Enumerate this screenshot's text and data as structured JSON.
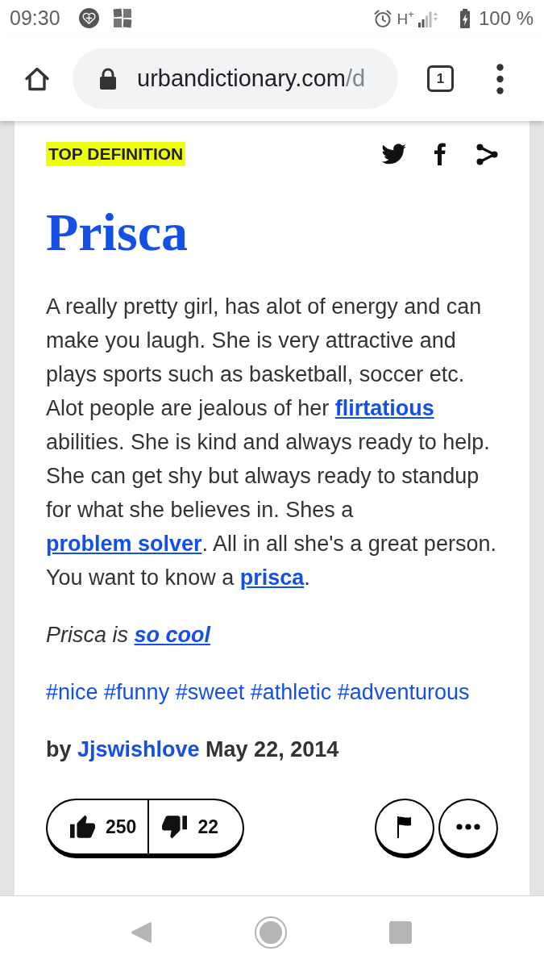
{
  "status_bar": {
    "time": "09:30",
    "network": "H$^{+}$",
    "battery": "100 %"
  },
  "browser_toolbar": {
    "url_host": "urbandictionary.com",
    "url_path": "/d",
    "tab_count": "1"
  },
  "definition": {
    "badge": "TOP DEFINITION",
    "word": "Prisca",
    "meaning": [
      {
        "kind": "text",
        "text": "A really pretty girl, has alot of energy and can make you laugh. She is very attractive and plays sports such as basketball, soccer etc. Alot people are jealous of her "
      },
      {
        "kind": "link",
        "text": "flirtatious"
      },
      {
        "kind": "text",
        "text": " abilities. She is kind and always ready to help. She can get shy but always ready to standup for what she believes in. Shes a "
      },
      {
        "kind": "link",
        "text": "problem solver"
      },
      {
        "kind": "text",
        "text": ". All in all she's a great person. You want to know a "
      },
      {
        "kind": "link",
        "text": "prisca"
      },
      {
        "kind": "text",
        "text": "."
      }
    ],
    "example": [
      {
        "kind": "text",
        "text": "Prisca is "
      },
      {
        "kind": "link",
        "text": "so cool"
      }
    ],
    "tags": [
      "#nice",
      "#funny",
      "#sweet",
      "#athletic",
      "#adventurous"
    ],
    "byline": [
      {
        "kind": "text",
        "text": "by "
      },
      {
        "kind": "link",
        "text": "Jjswishlove"
      },
      {
        "kind": "text",
        "text": " May 22, 2014"
      }
    ],
    "upvotes": "250",
    "downvotes": "22"
  }
}
